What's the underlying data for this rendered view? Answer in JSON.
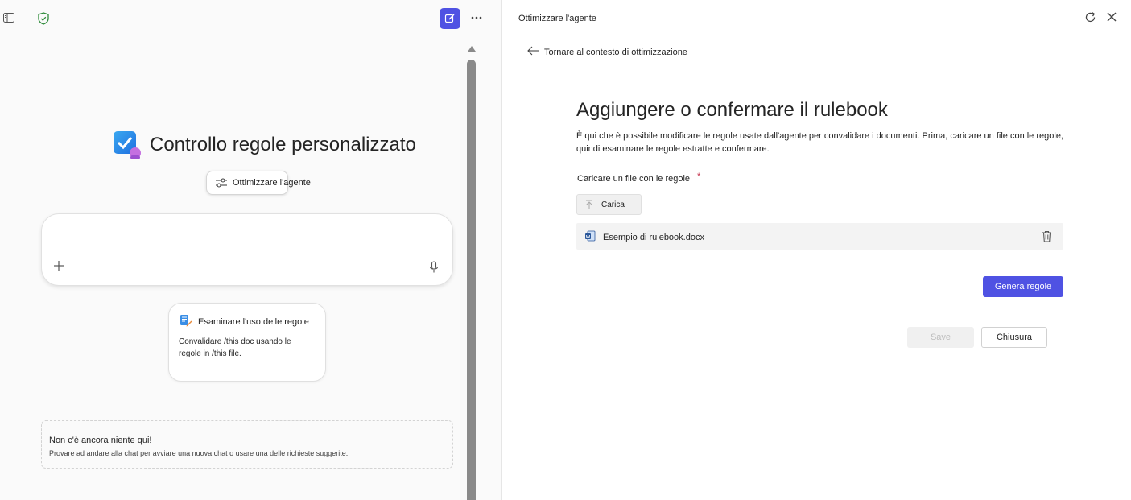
{
  "left": {
    "hero_title": "Controllo regole personalizzato",
    "optimize_label": "Ottimizzare l'agente",
    "suggestion": {
      "title": "Esaminare l'uso delle regole",
      "body": "Convalidare /this doc usando le regole in /this file."
    },
    "empty_state": {
      "title": "Non c'è ancora niente qui!",
      "subtitle": "Provare ad andare alla chat per avviare una nuova chat o usare una delle richieste suggerite."
    },
    "icons": [
      "sidebar-toggle-icon",
      "shield-check-icon",
      "compose-icon",
      "more-icon",
      "plus-icon",
      "microphone-icon"
    ]
  },
  "right": {
    "panel_title": "Ottimizzare l'agente",
    "back_label": "Tornare al contesto di ottimizzazione",
    "heading": "Aggiungere o confermare il rulebook",
    "description": "È qui che è possibile modificare le regole usate dall'agente per convalidare i documenti. Prima, caricare un file con le regole, quindi esaminare le regole estratte e confermare.",
    "upload_label": "Caricare un file con le regole",
    "required_mark": "*",
    "upload_button": "Carica",
    "file_name": "Esempio di rulebook.docx",
    "generate_button": "Genera regole",
    "save_button": "Save",
    "close_button": "Chiusura",
    "icons": [
      "refresh-icon",
      "close-icon",
      "arrow-left-icon",
      "upload-arrow-icon",
      "word-file-icon",
      "trash-icon"
    ]
  },
  "colors": {
    "accent": "#4f52e3",
    "required": "#c4314b",
    "left_bg": "#fafafa",
    "scrollbar": "#8a8a8a"
  }
}
